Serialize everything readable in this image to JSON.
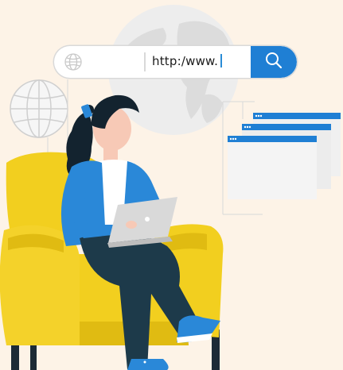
{
  "search": {
    "url_text": "http:/www.",
    "globe_icon": "globe-icon",
    "search_icon": "magnifier-icon"
  },
  "colors": {
    "background": "#fdf3e7",
    "accent_blue": "#1f7fd4",
    "chair_yellow": "#f2cf1f",
    "pants_dark": "#1d3a4a",
    "window_gray": "#f2f2f2"
  }
}
